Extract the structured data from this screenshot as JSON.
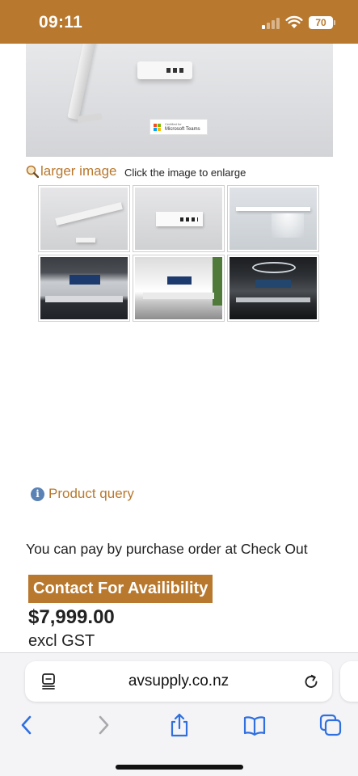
{
  "status_bar": {
    "time": "09:11",
    "battery": "70"
  },
  "gallery": {
    "badge_small": "Certified for",
    "badge_main": "Microsoft Teams",
    "larger_image_label": "larger image",
    "enlarge_hint": "Click the image to enlarge"
  },
  "product": {
    "query_label": "Product query",
    "purchase_order_text": "You can pay by purchase order at Check Out",
    "availability_label": "Contact For Availibility",
    "price": "$7,999.00",
    "tax_note": "excl GST"
  },
  "browser": {
    "url": "avsupply.co.nz"
  },
  "colors": {
    "brand": "#b8782e",
    "link": "#b8782e",
    "toolbar_icon": "#2f6fe0",
    "toolbar_disabled": "#a9a9ad",
    "info_icon": "#5a82b4"
  }
}
